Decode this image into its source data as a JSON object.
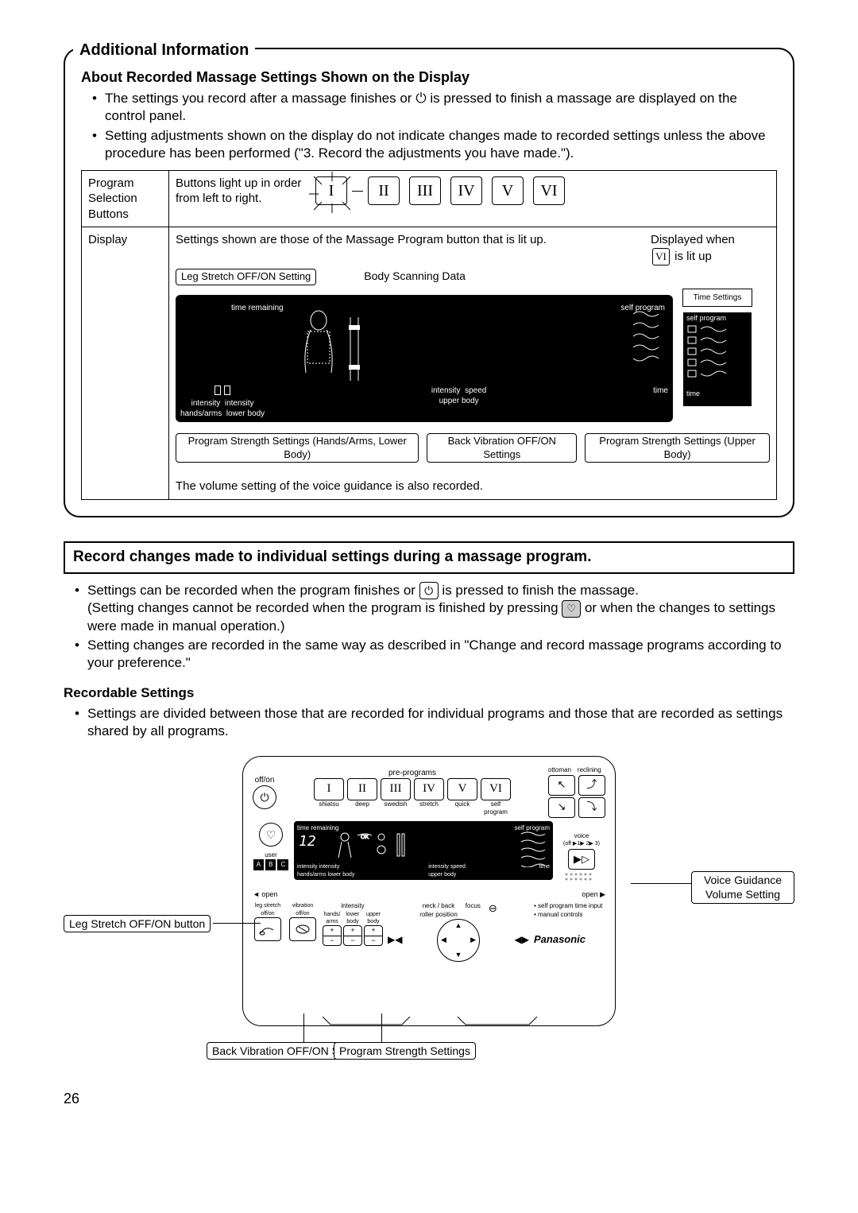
{
  "page_number": "26",
  "box": {
    "title": "Additional Information",
    "subheading": "About Recorded Massage Settings Shown on the Display",
    "bullets": [
      "The settings you record after a massage finishes or ⏻ is pressed to finish a massage are displayed on the control panel.",
      "Setting adjustments shown on the display do not indicate changes made to recorded settings unless the above procedure has been performed (\"3. Record the adjustments you have made.\")."
    ],
    "row1": {
      "left": "Program Selection Buttons",
      "right": "Buttons light up in order from left to right.",
      "romans": [
        "I",
        "II",
        "III",
        "IV",
        "V",
        "VI"
      ]
    },
    "row2": {
      "left": "Display",
      "top_note": "Settings shown are those of the Massage Program button that is lit up.",
      "leg_stretch": "Leg Stretch OFF/ON Setting",
      "body_scan": "Body Scanning Data",
      "displayed_when": "Displayed when",
      "is_lit": "is lit up",
      "roman_vi": "VI",
      "time_settings": "Time Settings",
      "self_program": "self program",
      "time_label": "time",
      "display_inner": {
        "time_remaining": "time remaining",
        "self_program": "self program",
        "intensity1": "intensity",
        "intensity2": "intensity",
        "hands_arms": "hands/arms",
        "lower_body": "lower body",
        "intensity3": "intensity",
        "speed": "speed",
        "upper_body": "upper body",
        "time": "time"
      },
      "psh": "Program Strength Settings (Hands/Arms, Lower Body)",
      "bvib": "Back Vibration OFF/ON Settings",
      "psu": "Program Strength Settings (Upper Body)",
      "volume_note": "The volume setting of the voice guidance is also recorded."
    }
  },
  "record": {
    "header": "Record changes made to individual settings during a massage program.",
    "b1a": "Settings can be recorded when the program finishes or ",
    "b1b": " is pressed to finish the massage.",
    "b1c": "(Setting changes cannot be recorded when the program is finished by pressing ",
    "b1d": " or when the changes to settings were made in manual operation.)",
    "b2": "Setting changes are recorded in the same way as described in \"Change and record massage programs according to your preference.\"",
    "subhead": "Recordable Settings",
    "b3": "Settings are divided between those that are recorded for individual programs and those that are recorded as settings shared by all programs."
  },
  "panel": {
    "off_on": "off/on",
    "pre_programs": "pre-programs",
    "ottoman": "ottoman",
    "reclining": "reclining",
    "romans": [
      "I",
      "II",
      "III",
      "IV",
      "V",
      "VI"
    ],
    "names": [
      "shiatsu",
      "deep",
      "swedish",
      "stretch",
      "quick",
      "self program"
    ],
    "time_remaining": "time remaining",
    "self_program": "self program",
    "user": "user",
    "abc": [
      "A",
      "B",
      "C"
    ],
    "intensity": "intensity",
    "hands_arms": "hands/arms",
    "lower_body": "lower body",
    "upper_body": "upper body",
    "speed": "speed",
    "time": "time",
    "voice": "voice",
    "voice_scale": "(off ▶1▶ 2▶ 3)",
    "open_l": "◄ open",
    "open_r": "open ▶",
    "leg_stretch_btn": "leg stretch off/on",
    "vibration_btn": "vibration off/on",
    "hands_arms2": "hands/ arms",
    "lower_body2": "lower body",
    "upper_body2": "upper body",
    "neck_back": "neck / back",
    "roller_position": "roller position",
    "focus": "focus",
    "note1": "• self program time input",
    "note2": "• manual controls",
    "brand": "Panasonic",
    "callouts": {
      "leg": "Leg Stretch OFF/ON button",
      "back_vib": "Back Vibration OFF/ON Setting",
      "prog_strength": "Program Strength Settings",
      "voice_guidance": "Voice Guidance Volume Setting"
    }
  }
}
